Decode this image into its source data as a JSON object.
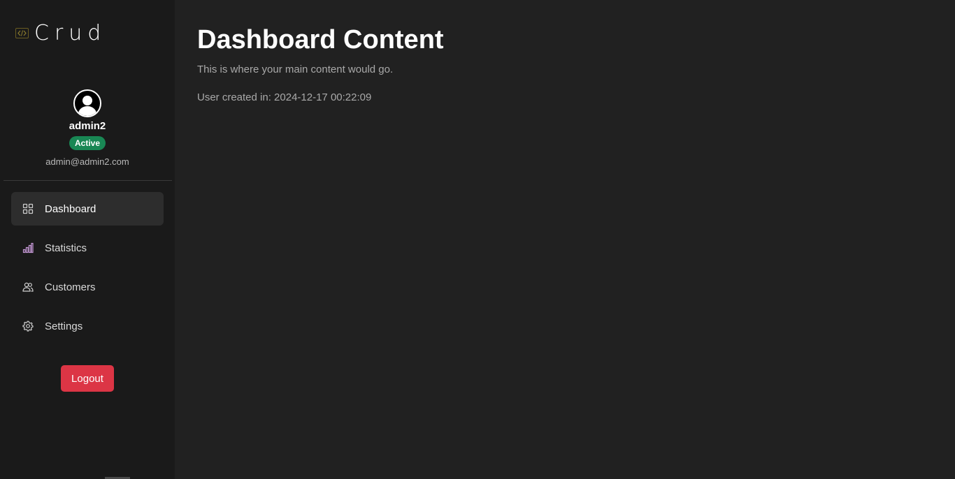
{
  "brand": {
    "name": "Crud",
    "icon": "code-icon",
    "icon_color": "#6b5d22"
  },
  "profile": {
    "avatar": "user-avatar-icon",
    "username": "admin2",
    "status": "Active",
    "status_color": "#198754",
    "email": "admin@admin2.com"
  },
  "nav": {
    "items": [
      {
        "label": "Dashboard",
        "icon": "grid-icon",
        "active": true
      },
      {
        "label": "Statistics",
        "icon": "bar-chart-icon",
        "active": false
      },
      {
        "label": "Customers",
        "icon": "users-icon",
        "active": false
      },
      {
        "label": "Settings",
        "icon": "gear-icon",
        "active": false
      }
    ]
  },
  "logout": {
    "label": "Logout",
    "color": "#dc3545"
  },
  "main": {
    "title": "Dashboard Content",
    "subtitle": "This is where your main content would go.",
    "created_text": "User created in: 2024-12-17 00:22:09"
  }
}
